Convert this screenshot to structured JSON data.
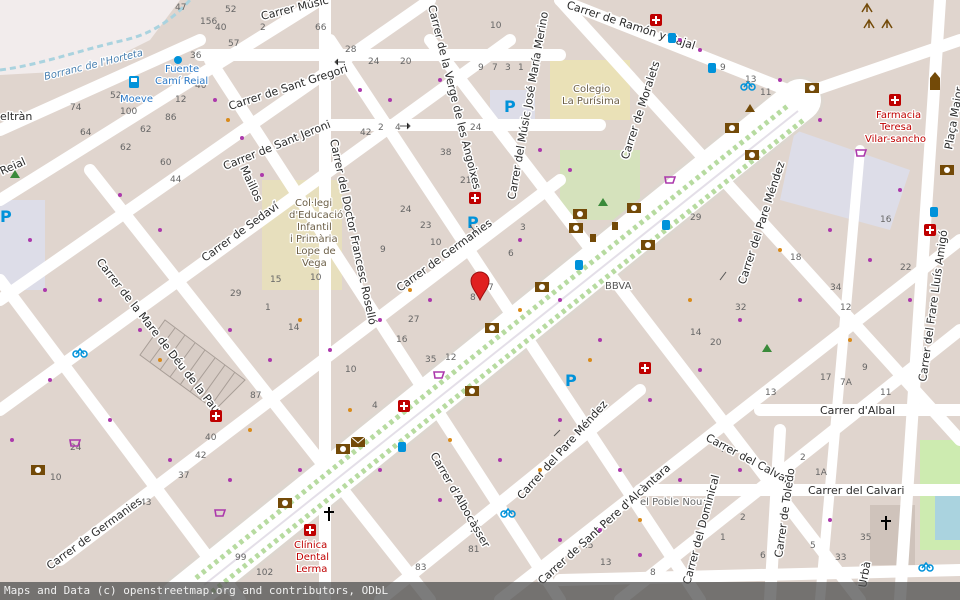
{
  "map": {
    "colors": {
      "background": "#efe4dc",
      "block": "#e0d5ce",
      "road": "#ffffff",
      "park": "#cdebb0",
      "pedestrian": "#dddde8",
      "water": "#aad3df",
      "pin": "#e02020",
      "shop": "#ac39ac",
      "health": "#bf0000",
      "transport": "#0092da"
    },
    "streets": [
      {
        "id": "carrer-de-germanies-1",
        "text": "Carrer de Germanies"
      },
      {
        "id": "carrer-de-germanies-2",
        "text": "Carrer de Germanies"
      },
      {
        "id": "carrer-de-sant-gregori",
        "text": "Carrer de Sant Gregori"
      },
      {
        "id": "carrer-de-sant-jeroni",
        "text": "Carrer de Sant Jeroni"
      },
      {
        "id": "carrer-de-sedavi",
        "text": "Carrer de Sedaví"
      },
      {
        "id": "carrer-de-la-mare-de-deu",
        "text": "Carrer de la Mare de Déu de la Pau"
      },
      {
        "id": "maillos",
        "text": "Maillos"
      },
      {
        "id": "carrer-del-doctor",
        "text": "Carrer del Doctor Francesc Roselló"
      },
      {
        "id": "carrer-de-la-verge",
        "text": "Carrer de la Verge de les Angoixes"
      },
      {
        "id": "carrer-musico-jose",
        "text": "Carrer del Músic José María Merino"
      },
      {
        "id": "carrer-music-top",
        "text": "Carrer Músic"
      },
      {
        "id": "carrer-de-ramon-y-cajal",
        "text": "Carrer de Ramón y Cajal"
      },
      {
        "id": "carrer-de-moralets",
        "text": "Carrer de Moralets"
      },
      {
        "id": "carrer-del-pare-mendez-1",
        "text": "Carrer del Pare Méndez"
      },
      {
        "id": "carrer-del-pare-mendez-2",
        "text": "Carrer del Pare Méndez"
      },
      {
        "id": "carrer-de-albocasser",
        "text": "Carrer d'Albocàsser"
      },
      {
        "id": "carrer-de-sant-pere",
        "text": "Carrer de Sant Pere d'Alcàntara"
      },
      {
        "id": "carrer-del-dominical",
        "text": "Carrer del Dominical"
      },
      {
        "id": "carrer-del-calvari-1",
        "text": "Carrer del Calvari"
      },
      {
        "id": "carrer-del-calvari-2",
        "text": "Carrer del Calvari"
      },
      {
        "id": "carrer-de-toledo",
        "text": "Carrer de Toledo"
      },
      {
        "id": "carrer-albal",
        "text": "Carrer d'Albal"
      },
      {
        "id": "carrer-frare",
        "text": "Carrer del Frare Lluís Amigó"
      },
      {
        "id": "placa-major",
        "text": "Plaça Major"
      },
      {
        "id": "beltran",
        "text": "eltràn"
      },
      {
        "id": "reial",
        "text": "Reial"
      },
      {
        "id": "urba",
        "text": "Urbà"
      }
    ],
    "pois": [
      {
        "id": "fuente",
        "text": "Fuente Camí Reial",
        "line1": "Fuente",
        "line2": "Camí Reial"
      },
      {
        "id": "moeve",
        "text": "Moeve"
      },
      {
        "id": "borranc",
        "text": "Borranc de l'Horteta"
      },
      {
        "id": "colegio",
        "line1": "Colegio",
        "line2": "La Purísima"
      },
      {
        "id": "collegi",
        "line1": "Col·legi",
        "line2": "d'Educació",
        "line3": "Infantil",
        "line4": "i Primària",
        "line5": "Lope de",
        "line6": "Vega"
      },
      {
        "id": "bbva",
        "text": "BBVA"
      },
      {
        "id": "farmacia",
        "line1": "Farmacia",
        "line2": "Teresa",
        "line3": "Vilar-sancho"
      },
      {
        "id": "clinica",
        "line1": "Clínica",
        "line2": "Dental",
        "line3": "Lerma"
      },
      {
        "id": "poble-nou",
        "text": "el Poble Nou"
      }
    ],
    "house_numbers": [
      "156",
      "52",
      "40",
      "47",
      "2",
      "1",
      "57",
      "36",
      "66",
      "28",
      "20",
      "24",
      "9",
      "7",
      "3",
      "1",
      "24",
      "40",
      "12",
      "52",
      "74",
      "100",
      "62",
      "64",
      "86",
      "62",
      "60",
      "44",
      "42",
      "2",
      "4",
      "6",
      "38",
      "14",
      "21",
      "24",
      "23",
      "10",
      "8",
      "6",
      "9",
      "15",
      "10",
      "29",
      "27",
      "16",
      "19",
      "35",
      "12",
      "10",
      "6",
      "8",
      "7",
      "3",
      "9",
      "15",
      "4",
      "1",
      "8",
      "31",
      "14",
      "20",
      "10",
      "37",
      "9",
      "13",
      "11",
      "29",
      "2",
      "13",
      "14",
      "20",
      "32",
      "18",
      "34",
      "12",
      "16",
      "22",
      "43",
      "17",
      "7A",
      "9",
      "3",
      "11",
      "13",
      "10",
      "7",
      "5",
      "2",
      "1A",
      "3",
      "2",
      "24",
      "10",
      "7",
      "43",
      "3",
      "20",
      "81",
      "83",
      "102",
      "99",
      "87",
      "40",
      "42",
      "37",
      "35",
      "33",
      "5",
      "6",
      "2",
      "1",
      "9",
      "8",
      "13",
      "15",
      "25",
      "18"
    ],
    "attribution": "Maps and Data (c) openstreetmap.org and contributors, ODbL"
  }
}
